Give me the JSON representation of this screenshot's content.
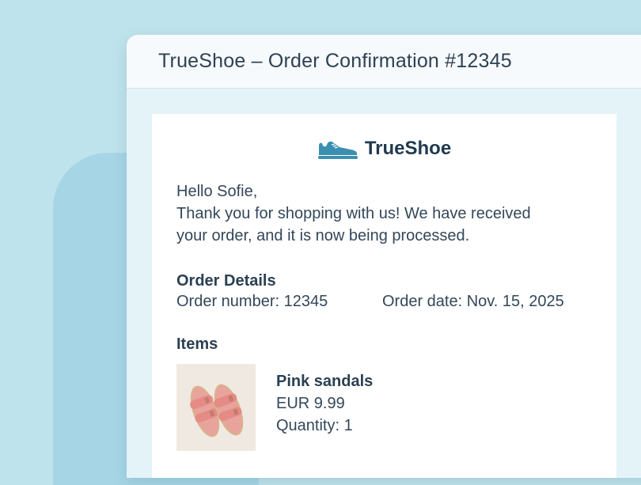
{
  "window": {
    "title": "TrueShoe – Order Confirmation #12345"
  },
  "brand": {
    "name": "TrueShoe",
    "logo_icon": "sneaker-icon",
    "accent_color": "#3a8fb0"
  },
  "email": {
    "greeting": "Hello Sofie,",
    "message_line1": "Thank you for shopping with us! We have received",
    "message_line2": "your order, and it is now being processed."
  },
  "order_details": {
    "heading": "Order Details",
    "order_number": "Order number: 12345",
    "order_date": "Order date: Nov. 15, 2025"
  },
  "items": {
    "heading": "Items",
    "list": [
      {
        "name": "Pink sandals",
        "price": "EUR 9.99",
        "quantity": "Quantity: 1",
        "image_icon": "pink-sandals-image"
      }
    ]
  }
}
